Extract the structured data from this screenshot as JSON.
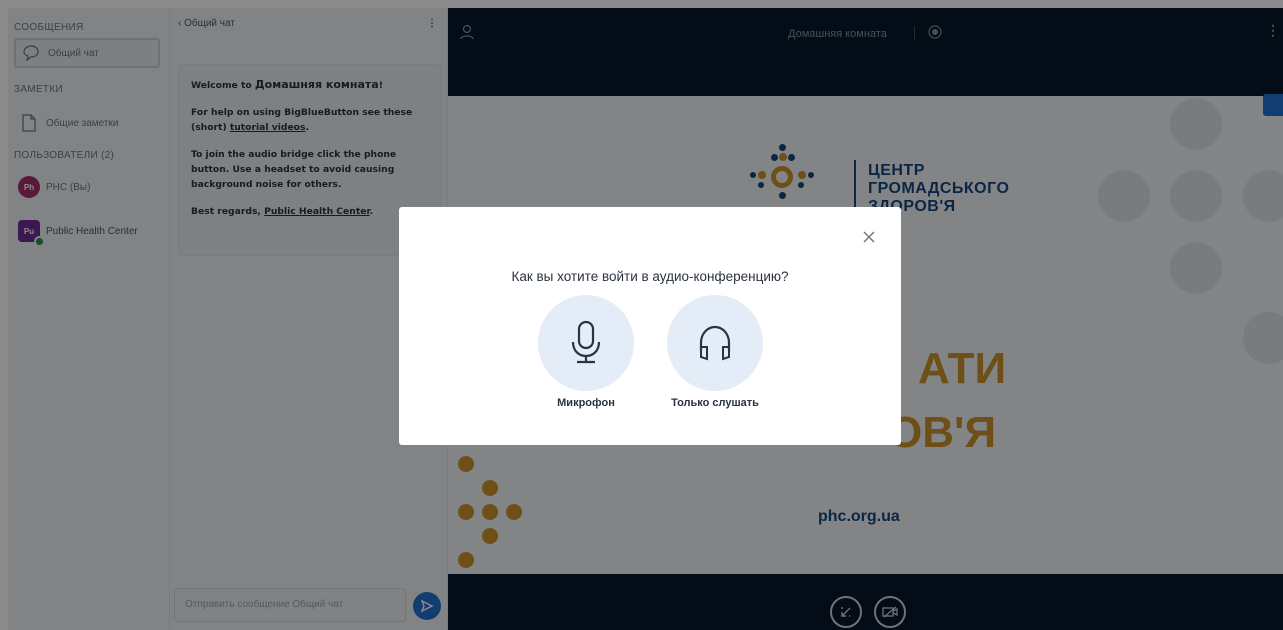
{
  "sidebar": {
    "messages_title": "СООБЩЕНИЯ",
    "public_chat_label": "Общий чат",
    "notes_title": "ЗАМЕТКИ",
    "shared_notes_label": "Общие заметки",
    "users_title": "ПОЛЬЗОВАТЕЛИ (2)",
    "users": [
      {
        "initials": "Ph",
        "name": "PHC (Вы)"
      },
      {
        "initials": "Pu",
        "name": "Public Health Center"
      }
    ]
  },
  "chat": {
    "back_label": "Общий чат",
    "welcome_prefix": "Welcome to",
    "room_name": "Домашняя комната",
    "welcome_suffix": "!",
    "help_prefix": "For help on using BigBlueButton see these (short)",
    "help_link": "tutorial videos",
    "help_suffix": ".",
    "audio_text": "To join the audio bridge click the phone button. Use a headset to avoid causing background noise for others.",
    "regards_prefix": "Best regards,",
    "regards_link": "Public Health Center",
    "regards_suffix": ".",
    "input_placeholder": "Отправить сообщение Общий чат"
  },
  "main": {
    "room_title": "Домашняя комната",
    "logo_lines": [
      "ЦЕНТР",
      "ГРОМАДСЬКОГО",
      "ЗДОРОВ'Я"
    ],
    "slogan_1": "АТИ",
    "slogan_2": "ОВ'Я",
    "site": "phc.org.ua"
  },
  "modal": {
    "title": "Как вы хотите войти в аудио-конференцию?",
    "mic_label": "Микрофон",
    "listen_label": "Только слушать"
  },
  "colors": {
    "accent": "#1f6fd0",
    "dark_bg": "#06172a",
    "brand_blue": "#15467a",
    "brand_orange": "#c9902a"
  }
}
